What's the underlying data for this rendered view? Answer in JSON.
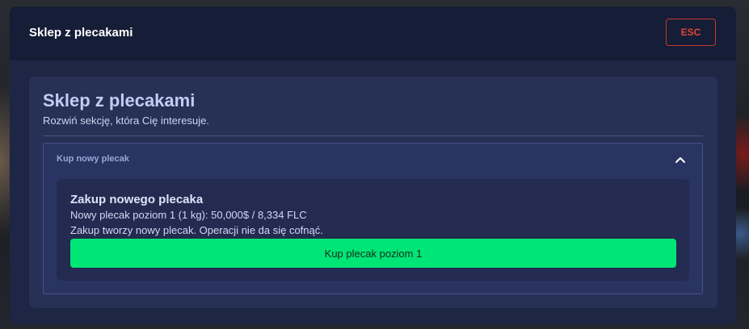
{
  "header": {
    "title": "Sklep z plecakami",
    "esc_label": "ESC"
  },
  "panel": {
    "title": "Sklep z plecakami",
    "subtitle": "Rozwiń sekcję, która Cię interesuje."
  },
  "accordion": {
    "label": "Kup nowy plecak",
    "expanded": true,
    "icon": "chevron-up-icon"
  },
  "card": {
    "title": "Zakup nowego plecaka",
    "price_text": "Nowy plecak poziom 1 (1 kg): 50,000$ / 8,334 FLC",
    "note": "Zakup tworzy nowy plecak. Operacji nie da się cofnąć.",
    "button_label": "Kup plecak poziom 1"
  },
  "colors": {
    "accent_green": "#00e676",
    "esc_red": "#e0453a",
    "modal_bg": "#1e2645",
    "header_bg": "#161d36"
  }
}
